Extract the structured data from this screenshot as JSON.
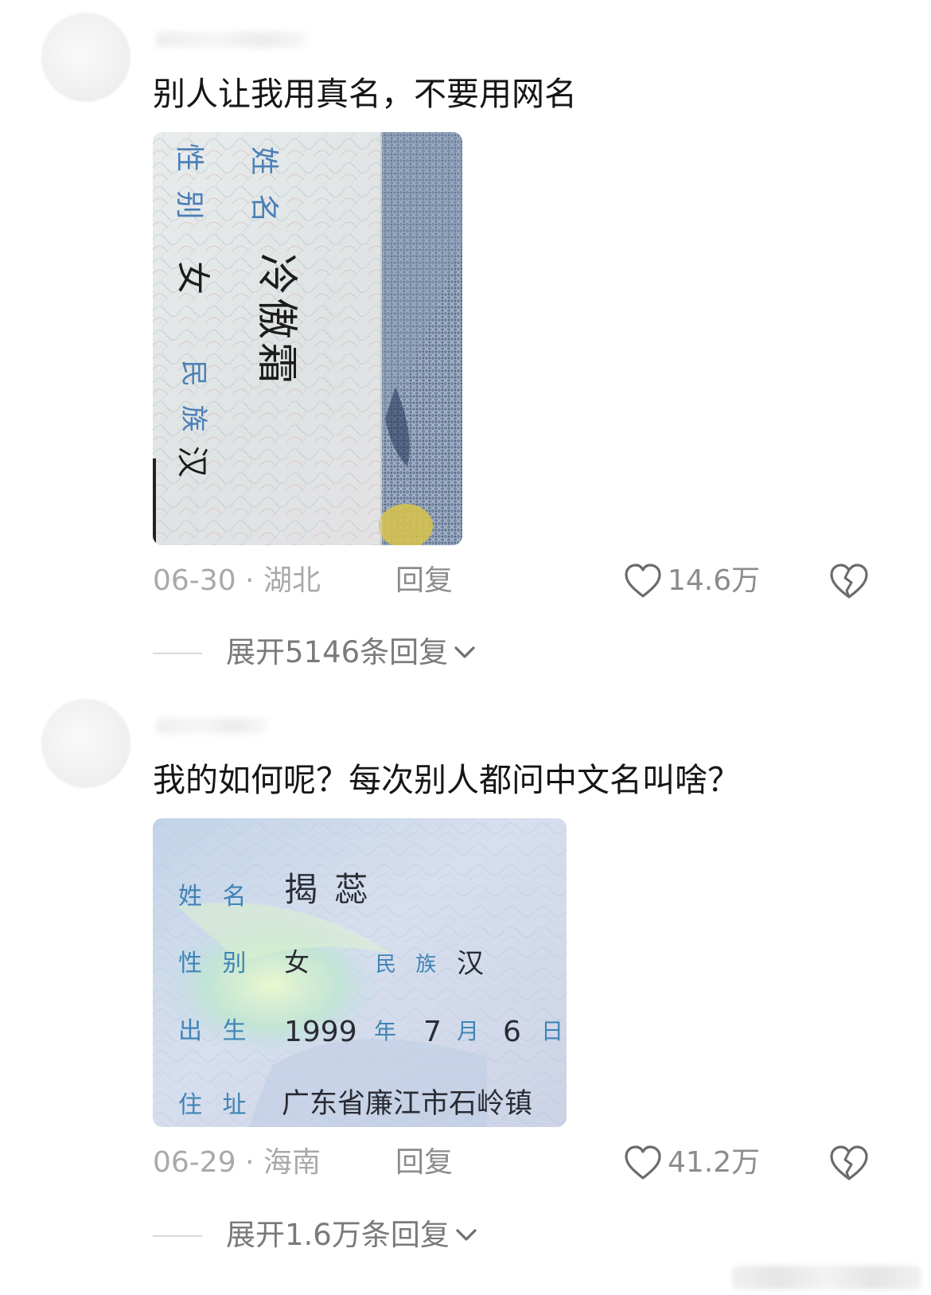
{
  "comments": [
    {
      "text": "别人让我用真名，不要用网名",
      "date": "06-30",
      "location": "湖北",
      "reply_label": "回复",
      "likes": "14.6万",
      "expand_label": "展开5146条回复",
      "photo": {
        "lines": [
          "姓 名",
          "冷傲霜",
          "性 别",
          "女",
          "民 族",
          "汉"
        ]
      }
    },
    {
      "text": "我的如何呢？每次别人都问中文名叫啥？",
      "date": "06-29",
      "location": "海南",
      "reply_label": "回复",
      "likes": "41.2万",
      "expand_label": "展开1.6万条回复",
      "photo": {
        "name_label": "姓 名",
        "name": "揭 蕊",
        "gender_label": "性 别",
        "gender": "女",
        "ethnicity_label": "民 族",
        "ethnicity": "汉",
        "birth_label": "出 生",
        "birth_year": "1999",
        "year_char": "年",
        "birth_month": "7",
        "month_char": "月",
        "birth_day": "6",
        "day_char": "日",
        "address_label": "住 址",
        "address": "广东省廉江市石岭镇"
      }
    }
  ],
  "icons": {
    "like": "heart-outline-icon",
    "dislike": "broken-heart-icon",
    "expand": "chevron-down-icon"
  },
  "colors": {
    "meta_gray": "#a9a9a9",
    "action_gray": "#8c8c8c",
    "expand_gray": "#7a7a7a",
    "text": "#161616"
  }
}
